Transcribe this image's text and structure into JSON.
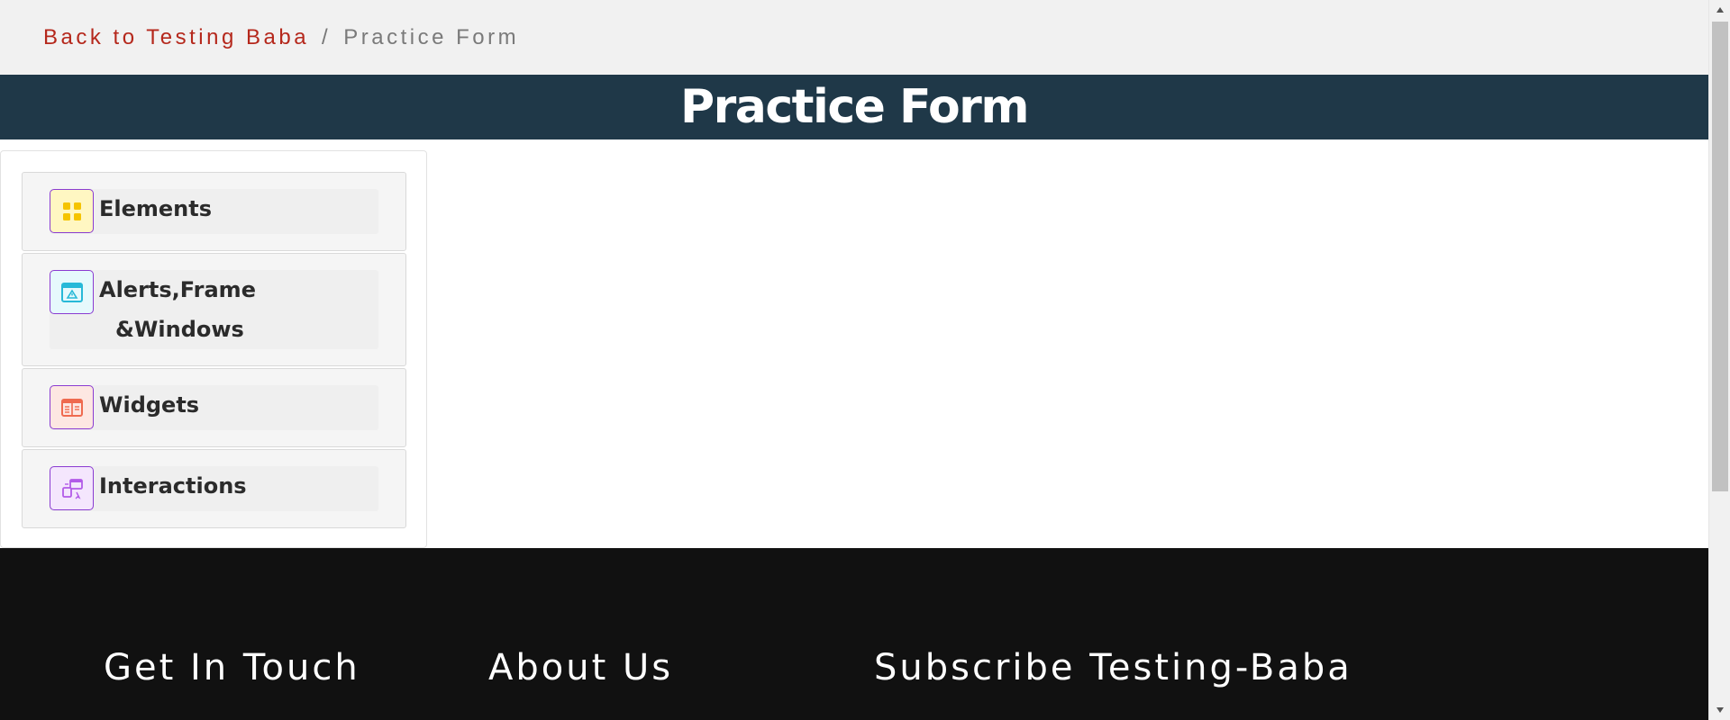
{
  "breadcrumb": {
    "back_link": "Back to Testing Baba",
    "separator": "/",
    "current": "Practice Form"
  },
  "page_title": "Practice Form",
  "sidebar": {
    "groups": [
      {
        "label": "Elements",
        "icon": "grid-icon",
        "icon_bg": "#fff7c2",
        "icon_color": "#f5c400"
      },
      {
        "label_line1": "Alerts,Frame",
        "label_line2": "&Windows",
        "icon": "browser-window-icon",
        "icon_bg": "#e6f9fc",
        "icon_color": "#27b9d8"
      },
      {
        "label": "Widgets",
        "icon": "widget-panel-icon",
        "icon_bg": "#fde7e2",
        "icon_color": "#ef6a4f"
      },
      {
        "label": "Interactions",
        "icon": "interaction-icon",
        "icon_bg": "#f4e6fd",
        "icon_color": "#b25ae8"
      }
    ]
  },
  "footer": {
    "headings": [
      "Get In Touch",
      "About Us",
      "Subscribe Testing-Baba"
    ]
  },
  "colors": {
    "breadcrumb_link": "#b5281c",
    "title_bar": "#1f3848",
    "footer_bg": "#111111",
    "icon_border": "#8a3bd1"
  }
}
